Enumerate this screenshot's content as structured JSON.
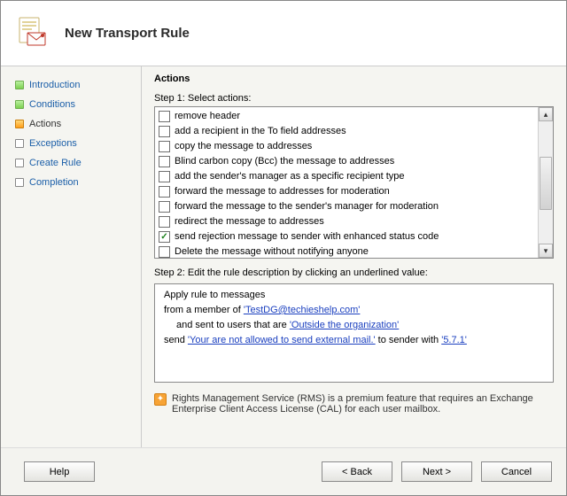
{
  "header": {
    "title": "New Transport Rule"
  },
  "sidebar": {
    "items": [
      {
        "label": "Introduction",
        "state": "done"
      },
      {
        "label": "Conditions",
        "state": "done"
      },
      {
        "label": "Actions",
        "state": "current"
      },
      {
        "label": "Exceptions",
        "state": "pending"
      },
      {
        "label": "Create Rule",
        "state": "pending"
      },
      {
        "label": "Completion",
        "state": "pending"
      }
    ]
  },
  "content": {
    "heading": "Actions",
    "step1_label": "Step 1: Select actions:",
    "actions": [
      {
        "label": "remove header",
        "checked": false
      },
      {
        "label": "add a recipient in the To field addresses",
        "checked": false
      },
      {
        "label": "copy the message to addresses",
        "checked": false
      },
      {
        "label": "Blind carbon copy (Bcc) the message to addresses",
        "checked": false
      },
      {
        "label": "add the sender's manager as a specific recipient type",
        "checked": false
      },
      {
        "label": "forward the message to addresses for moderation",
        "checked": false
      },
      {
        "label": "forward the message to the sender's manager for moderation",
        "checked": false
      },
      {
        "label": "redirect the message to addresses",
        "checked": false
      },
      {
        "label": "send rejection message to sender with enhanced status code",
        "checked": true
      },
      {
        "label": "Delete the message without notifying anyone",
        "checked": false
      }
    ],
    "step2_label": "Step 2: Edit the rule description by clicking an underlined value:",
    "rule": {
      "apply_line": "Apply rule to messages",
      "from_prefix": "from a member of ",
      "from_value": "'TestDG@techieshelp.com'",
      "scope_prefix": "and sent to users that are ",
      "scope_value": "'Outside the organization'",
      "send_prefix": "send ",
      "rej_msg": "'Your are not allowed to send external mail.'",
      "send_mid": " to sender with ",
      "status_code": "'5.7.1'"
    },
    "rms_note": "Rights Management Service (RMS) is a premium feature that requires an Exchange Enterprise Client Access License (CAL) for each user mailbox."
  },
  "footer": {
    "help": "Help",
    "back": "< Back",
    "next": "Next >",
    "cancel": "Cancel"
  }
}
